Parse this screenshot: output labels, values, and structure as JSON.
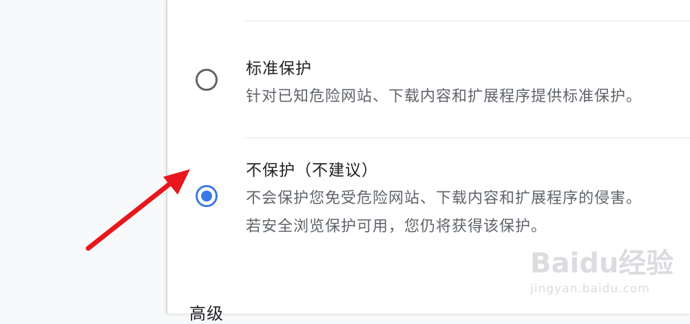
{
  "safe_browsing": {
    "options": [
      {
        "title": "标准保护",
        "description": [
          "针对已知危险网站、下载内容和扩展程序提供标准保护。"
        ],
        "selected": false
      },
      {
        "title": "不保护（不建议）",
        "description": [
          "不会保护您免受危险网站、下载内容和扩展程序的侵害。",
          "若安全浏览保护可用，您仍将获得该保护。"
        ],
        "selected": true
      }
    ],
    "advanced_heading": "高级"
  },
  "accent_color": "#3b78e7",
  "annotation_color": "#e8171b",
  "watermark": {
    "logo": "Baidu经验",
    "url": "jingyan.baidu.com"
  }
}
